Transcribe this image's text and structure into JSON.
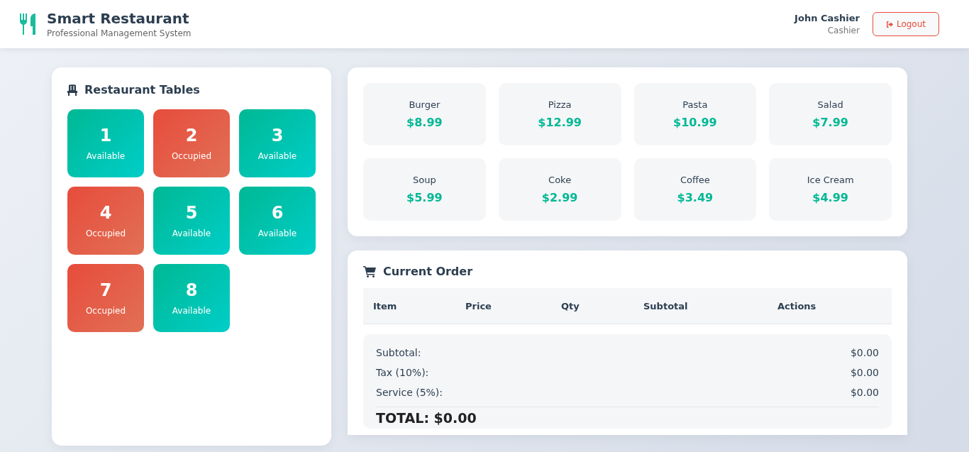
{
  "header": {
    "title": "Smart Restaurant",
    "subtitle": "Professional Management System",
    "user_name": "John Cashier",
    "user_role": "Cashier",
    "logout": "Logout"
  },
  "tables_panel": {
    "title": "Restaurant Tables",
    "tables": [
      {
        "number": "1",
        "status": "Available",
        "occupied": false
      },
      {
        "number": "2",
        "status": "Occupied",
        "occupied": true
      },
      {
        "number": "3",
        "status": "Available",
        "occupied": false
      },
      {
        "number": "4",
        "status": "Occupied",
        "occupied": true
      },
      {
        "number": "5",
        "status": "Available",
        "occupied": false
      },
      {
        "number": "6",
        "status": "Available",
        "occupied": false
      },
      {
        "number": "7",
        "status": "Occupied",
        "occupied": true
      },
      {
        "number": "8",
        "status": "Available",
        "occupied": false
      }
    ]
  },
  "menu": [
    {
      "name": "Burger",
      "price": "$8.99"
    },
    {
      "name": "Pizza",
      "price": "$12.99"
    },
    {
      "name": "Pasta",
      "price": "$10.99"
    },
    {
      "name": "Salad",
      "price": "$7.99"
    },
    {
      "name": "Soup",
      "price": "$5.99"
    },
    {
      "name": "Coke",
      "price": "$2.99"
    },
    {
      "name": "Coffee",
      "price": "$3.49"
    },
    {
      "name": "Ice Cream",
      "price": "$4.99"
    }
  ],
  "order": {
    "title": "Current Order",
    "columns": [
      "Item",
      "Price",
      "Qty",
      "Subtotal",
      "Actions"
    ],
    "summary": [
      {
        "label": "Subtotal:",
        "value": "$0.00"
      },
      {
        "label": "Tax (10%):",
        "value": "$0.00"
      },
      {
        "label": "Service (5%):",
        "value": "$0.00"
      }
    ],
    "total": "TOTAL: $0.00"
  }
}
